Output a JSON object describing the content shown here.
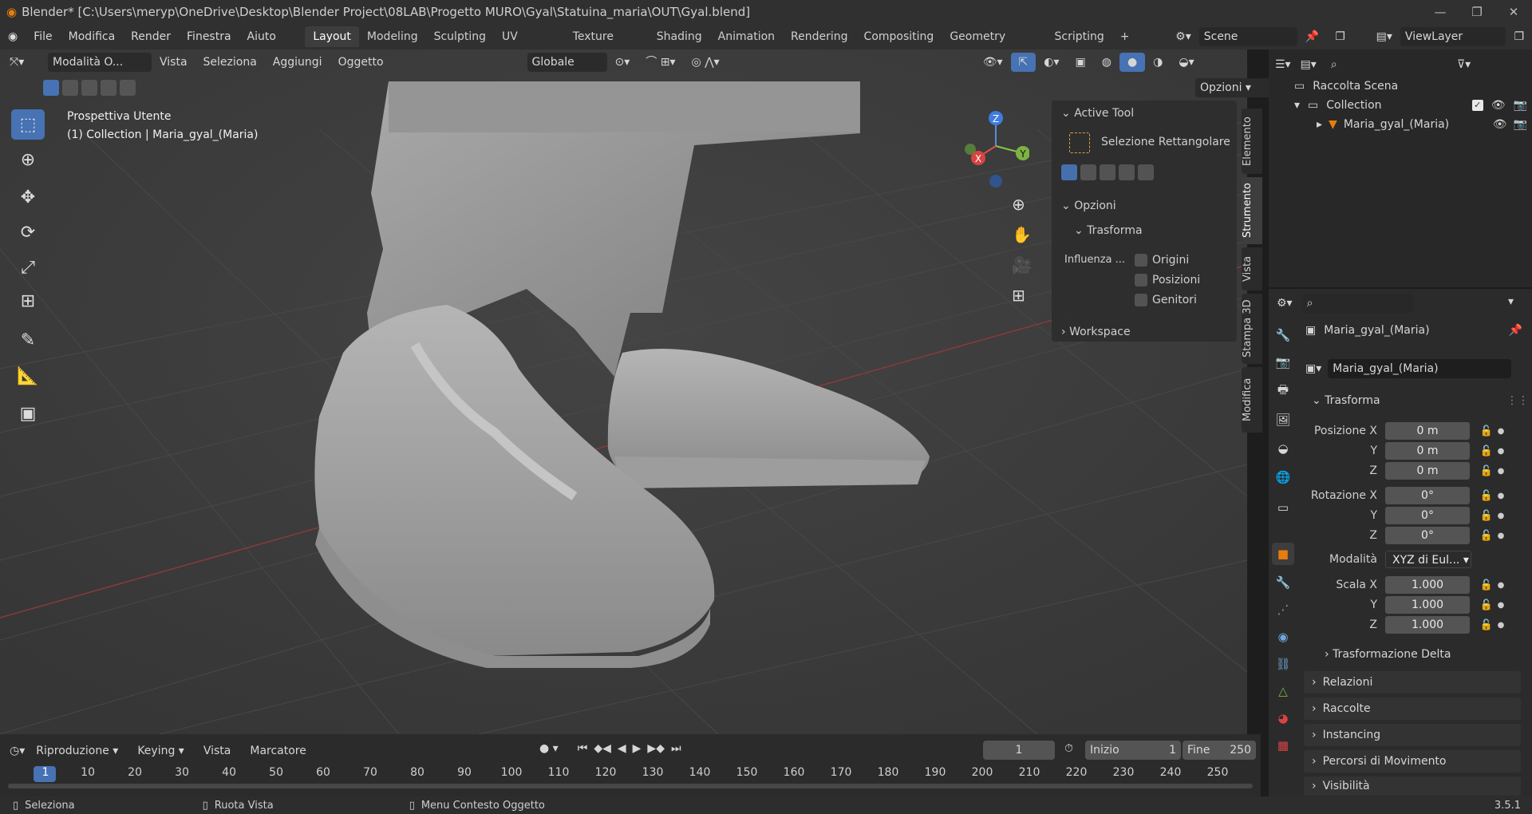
{
  "window": {
    "title": "Blender* [C:\\Users\\meryp\\OneDrive\\Desktop\\Blender Project\\08LAB\\Progetto MURO\\Gyal\\Statuina_maria\\OUT\\Gyal.blend]"
  },
  "menus": [
    "File",
    "Modifica",
    "Render",
    "Finestra",
    "Aiuto"
  ],
  "workspaces": [
    "Layout",
    "Modeling",
    "Sculpting",
    "UV Editing",
    "Texture Paint",
    "Shading",
    "Animation",
    "Rendering",
    "Compositing",
    "Geometry Nodes",
    "Scripting"
  ],
  "scene": "Scene",
  "view_layer": "ViewLayer",
  "viewport": {
    "mode": "Modalità O...",
    "menus": [
      "Vista",
      "Seleziona",
      "Aggiungi",
      "Oggetto"
    ],
    "orientation": "Globale",
    "options_btn": "Opzioni",
    "overlay_line1": "Prospettiva Utente",
    "overlay_line2": "(1) Collection | Maria_gyal_(Maria)",
    "gizmo": {
      "x": "X",
      "y": "Y",
      "z": "Z"
    }
  },
  "npanel": {
    "active_tool_header": "Active Tool",
    "tool_name": "Selezione Rettangolare",
    "opzioni_header": "Opzioni",
    "trasforma_header": "Trasforma",
    "influenza_label": "Influenza ...",
    "checks": [
      "Origini",
      "Posizioni",
      "Genitori"
    ],
    "workspace_header": "Workspace",
    "tabs": [
      "Elemento",
      "Strumento",
      "Vista",
      "Stampa 3D",
      "Modifica"
    ]
  },
  "outliner": {
    "root": "Raccolta Scena",
    "collection": "Collection",
    "object": "Maria_gyal_(Maria)"
  },
  "properties": {
    "object_name": "Maria_gyal_(Maria)",
    "data_name": "Maria_gyal_(Maria)",
    "trasforma": "Trasforma",
    "posizione_label": "Posizione X",
    "rotazione_label": "Rotazione X",
    "scala_label": "Scala X",
    "y": "Y",
    "z": "Z",
    "pos": [
      "0 m",
      "0 m",
      "0 m"
    ],
    "rot": [
      "0°",
      "0°",
      "0°"
    ],
    "scale": [
      "1.000",
      "1.000",
      "1.000"
    ],
    "modalita_label": "Modalità",
    "modalita_value": "XYZ di Eul...",
    "delta": "Trasformazione Delta",
    "sections": [
      "Relazioni",
      "Raccolte",
      "Instancing",
      "Percorsi di Movimento",
      "Visibilità"
    ]
  },
  "timeline": {
    "menus": [
      "Riproduzione",
      "Keying",
      "Vista",
      "Marcatore"
    ],
    "current_frame": "1",
    "inizio_label": "Inizio",
    "inizio": "1",
    "fine_label": "Fine",
    "fine": "250",
    "ticks": [
      "1",
      "10",
      "20",
      "30",
      "40",
      "50",
      "60",
      "70",
      "80",
      "90",
      "100",
      "110",
      "120",
      "130",
      "140",
      "150",
      "160",
      "170",
      "180",
      "190",
      "200",
      "210",
      "220",
      "230",
      "240",
      "250"
    ]
  },
  "status": {
    "left": "Seleziona",
    "middle": "Ruota Vista",
    "right": "Menu Contesto Oggetto",
    "version": "3.5.1"
  }
}
